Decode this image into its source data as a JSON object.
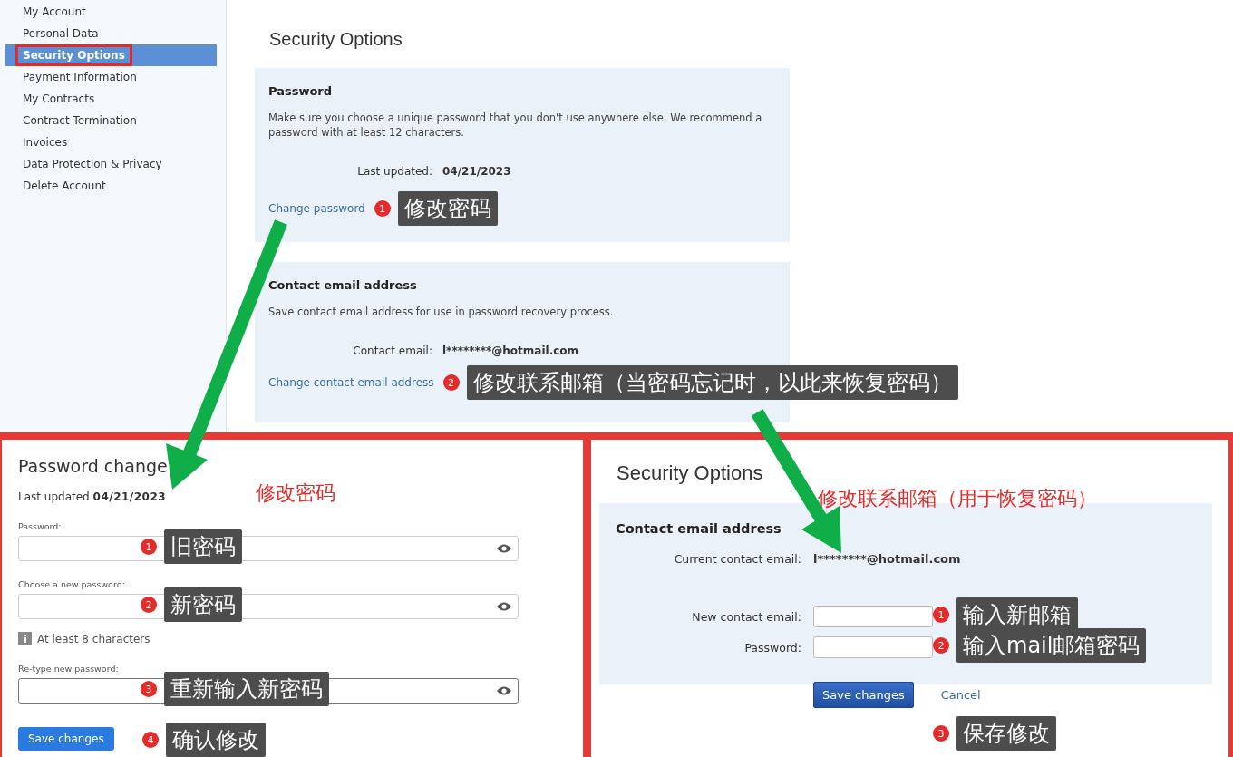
{
  "sidebar": {
    "items": [
      {
        "label": "My Account",
        "selected": false
      },
      {
        "label": "Personal Data",
        "selected": false
      },
      {
        "label": "Security Options",
        "selected": true
      },
      {
        "label": "Payment Information",
        "selected": false
      },
      {
        "label": "My Contracts",
        "selected": false
      },
      {
        "label": "Contract Termination",
        "selected": false
      },
      {
        "label": "Invoices",
        "selected": false
      },
      {
        "label": "Data Protection & Privacy",
        "selected": false
      },
      {
        "label": "Delete Account",
        "selected": false
      }
    ]
  },
  "security_page": {
    "title": "Security Options",
    "password_panel": {
      "heading": "Password",
      "description": "Make sure you choose a unique password that you don't use anywhere else. We recommend a password with at least 12 characters.",
      "last_updated_label": "Last updated:",
      "last_updated_value": "04/21/2023",
      "link": "Change password",
      "annotation": {
        "number": "1",
        "text": "修改密码"
      }
    },
    "email_panel": {
      "heading": "Contact email address",
      "description": "Save contact email address for use in password recovery process.",
      "contact_label": "Contact email:",
      "contact_value": "l********@hotmail.com",
      "link": "Change contact email address",
      "annotation": {
        "number": "2",
        "text": "修改联系邮箱（当密码忘记时，以此来恢复密码）"
      }
    }
  },
  "password_change": {
    "title": "Password change",
    "annotation_title": "修改密码",
    "last_updated_label": "Last updated",
    "last_updated_value": "04/21/2023",
    "fields": [
      {
        "label": "Password:",
        "focused": false,
        "annotation": {
          "number": "1",
          "text": "旧密码"
        }
      },
      {
        "label": "Choose a new password:",
        "focused": false,
        "hint": "At least 8 characters",
        "annotation": {
          "number": "2",
          "text": "新密码"
        }
      },
      {
        "label": "Re-type new password:",
        "focused": true,
        "annotation": {
          "number": "3",
          "text": "重新输入新密码"
        }
      }
    ],
    "save_button": "Save changes",
    "save_annotation": {
      "number": "4",
      "text": "确认修改"
    }
  },
  "email_change": {
    "title": "Security Options",
    "annotation_title": "修改联系邮箱（用于恢复密码）",
    "heading": "Contact email address",
    "current_label": "Current contact email:",
    "current_value": "l********@hotmail.com",
    "fields": [
      {
        "label": "New contact email:",
        "annotation": {
          "number": "1",
          "text": "输入新邮箱"
        }
      },
      {
        "label": "Password:",
        "annotation": {
          "number": "2",
          "text": "输入mail邮箱密码"
        }
      }
    ],
    "save_button": "Save changes",
    "cancel_link": "Cancel",
    "save_annotation": {
      "number": "3",
      "text": "保存修改"
    }
  }
}
